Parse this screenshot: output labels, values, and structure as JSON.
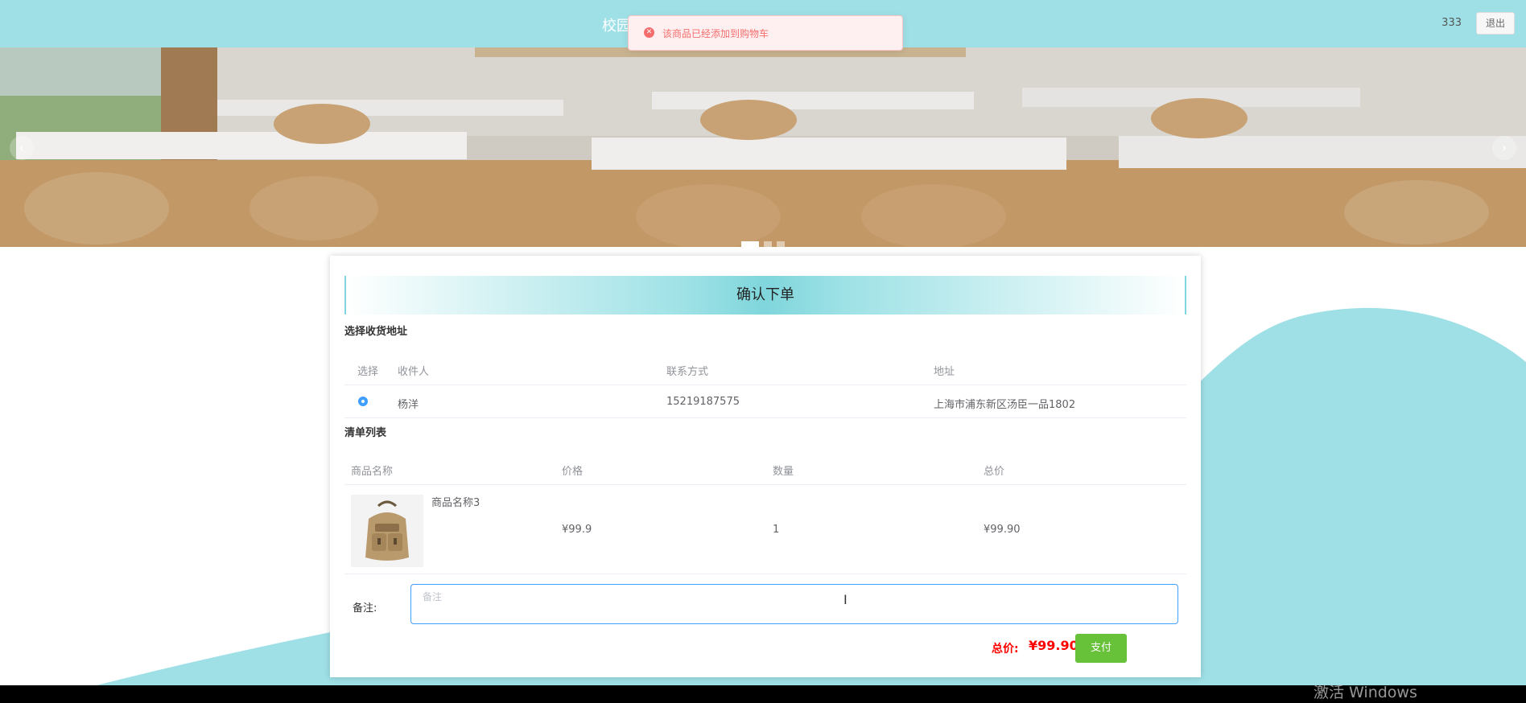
{
  "header": {
    "site_title": "校园",
    "username": "333",
    "logout_label": "退出"
  },
  "toast": {
    "message": "该商品已经添加到购物车"
  },
  "banner": {
    "prev_label": "‹",
    "next_label": "›",
    "slide_count": 3,
    "active_slide": 1
  },
  "order": {
    "title": "确认下单",
    "address_section_title": "选择收货地址",
    "address_table": {
      "headers": [
        "选择",
        "收件人",
        "联系方式",
        "地址"
      ],
      "rows": [
        {
          "selected": true,
          "recipient": "杨洋",
          "phone": "15219187575",
          "address": "上海市浦东新区汤臣一品1802"
        }
      ]
    },
    "items_section_title": "清单列表",
    "items_table": {
      "headers": [
        "商品名称",
        "价格",
        "数量",
        "总价"
      ],
      "rows": [
        {
          "name": "商品名称3",
          "price": "¥99.9",
          "quantity": "1",
          "subtotal": "¥99.90"
        }
      ]
    },
    "remark_label": "备注:",
    "remark_placeholder": "备注",
    "remark_value": "",
    "total_label": "总价:",
    "total_value": "¥99.90",
    "pay_label": "支付"
  },
  "os": {
    "watermark": "激活 Windows"
  },
  "colors": {
    "teal": "#9ee0e6",
    "pay_green": "#67c23a",
    "total_red": "#ff0000",
    "radio_blue": "#409eff",
    "toast_red": "#f56c6c"
  }
}
